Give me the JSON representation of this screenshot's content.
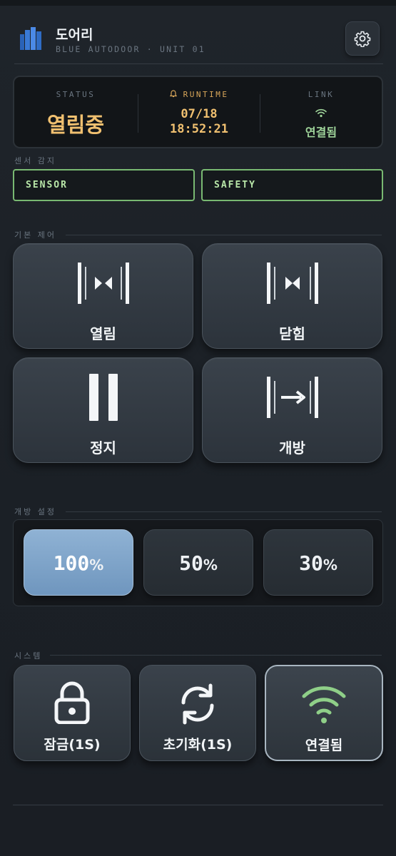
{
  "header": {
    "title": "도어리",
    "subtitle": "BLUE AUTODOOR · UNIT 01"
  },
  "status_panel": {
    "status_label": "STATUS",
    "status_value": "열림중",
    "runtime_label": "RUNTIME",
    "runtime_date": "07/18",
    "runtime_time": "18:52:21",
    "link_label": "LINK",
    "link_value": "연결됨"
  },
  "sensors": {
    "section_label": "센서 감지",
    "items": [
      "SENSOR",
      "SAFETY"
    ]
  },
  "basic_control": {
    "section_label": "기본 제어",
    "buttons": [
      "열림",
      "닫힘",
      "정지",
      "개방"
    ]
  },
  "open_setting": {
    "section_label": "개방 설정",
    "options": [
      "100",
      "50",
      "30"
    ],
    "unit": "%",
    "selected": "100"
  },
  "system": {
    "section_label": "시스템",
    "buttons": [
      "잠금(1S)",
      "초기화(1S)",
      "연결됨"
    ]
  },
  "colors": {
    "accent_amber": "#f0c070",
    "link_green": "#9fd49a",
    "sensor_green": "#79b972",
    "selected_blue": "#7fa4c9"
  },
  "icons": {
    "logo": "building-logo-icon",
    "settings": "gear-icon",
    "runtime": "bell-icon",
    "link": "wifi-icon",
    "open": "door-open-icon",
    "close": "door-close-icon",
    "stop": "pause-icon",
    "hold_open": "door-hold-open-icon",
    "lock": "lock-icon",
    "reset": "refresh-icon",
    "connected": "wifi-icon"
  }
}
